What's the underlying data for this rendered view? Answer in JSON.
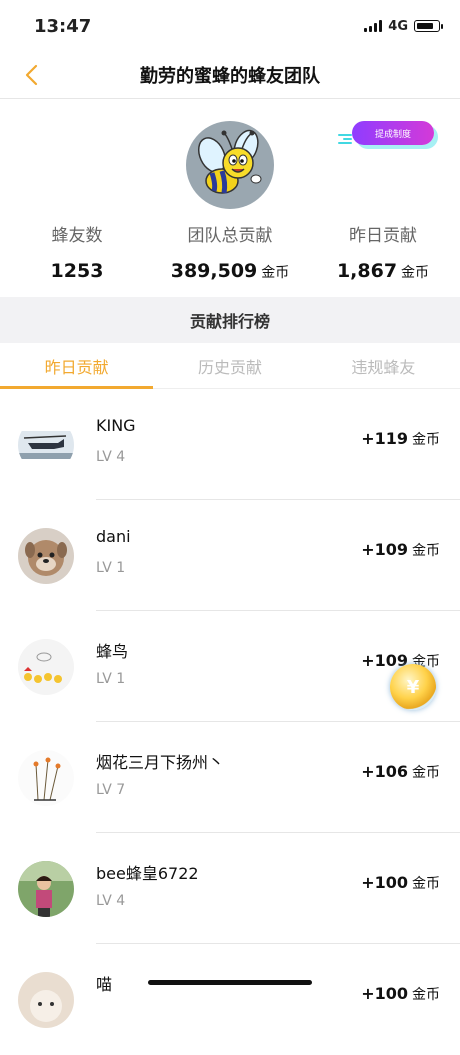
{
  "status_bar": {
    "time": "13:47",
    "network": "4G"
  },
  "nav": {
    "title": "勤劳的蜜蜂的蜂友团队"
  },
  "header": {
    "rules_button": "提成制度",
    "stats": [
      {
        "label": "蜂友数",
        "value": "1253",
        "unit": ""
      },
      {
        "label": "团队总贡献",
        "value": "389,509",
        "unit": "金币"
      },
      {
        "label": "昨日贡献",
        "value": "1,867",
        "unit": "金币"
      }
    ]
  },
  "ranking": {
    "title": "贡献排行榜"
  },
  "tabs": [
    {
      "label": "昨日贡献",
      "active": true
    },
    {
      "label": "历史贡献",
      "active": false
    },
    {
      "label": "违规蜂友",
      "active": false
    }
  ],
  "rows": [
    {
      "name": "KING",
      "level": "LV 4",
      "score": "+119",
      "unit": "金币"
    },
    {
      "name": "dani",
      "level": "LV 1",
      "score": "+109",
      "unit": "金币"
    },
    {
      "name": "蜂鸟",
      "level": "LV 1",
      "score": "+109",
      "unit": "金币"
    },
    {
      "name": "烟花三月下扬州丶",
      "level": "LV 7",
      "score": "+106",
      "unit": "金币"
    },
    {
      "name": "bee蜂皇6722",
      "level": "LV 4",
      "score": "+100",
      "unit": "金币"
    },
    {
      "name": "喵",
      "level": "",
      "score": "+100",
      "unit": "金币"
    }
  ],
  "floating_coin": {
    "symbol": "¥"
  },
  "colors": {
    "accent": "#f2a930",
    "rules_gradient_start": "#8f3dff",
    "rules_gradient_end": "#d43ad8"
  }
}
